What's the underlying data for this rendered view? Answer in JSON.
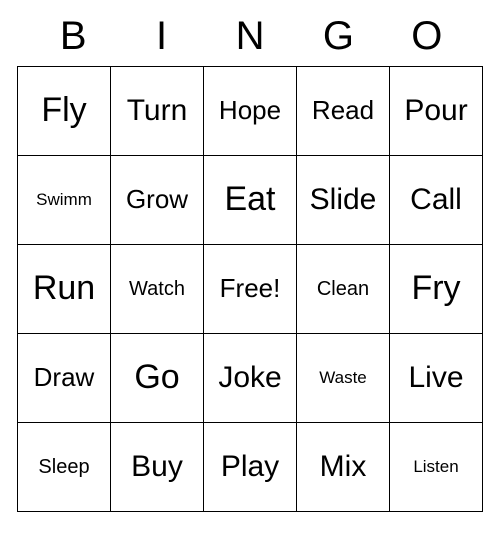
{
  "card": {
    "title_letters": [
      "B",
      "I",
      "N",
      "G",
      "O"
    ],
    "grid": [
      [
        {
          "text": "Fly",
          "size": "xl"
        },
        {
          "text": "Turn",
          "size": "lg"
        },
        {
          "text": "Hope",
          "size": "md"
        },
        {
          "text": "Read",
          "size": "md"
        },
        {
          "text": "Pour",
          "size": "lg"
        }
      ],
      [
        {
          "text": "Swimm",
          "size": "xs"
        },
        {
          "text": "Grow",
          "size": "md"
        },
        {
          "text": "Eat",
          "size": "xl"
        },
        {
          "text": "Slide",
          "size": "lg"
        },
        {
          "text": "Call",
          "size": "lg"
        }
      ],
      [
        {
          "text": "Run",
          "size": "xl"
        },
        {
          "text": "Watch",
          "size": "sm"
        },
        {
          "text": "Free!",
          "size": "md"
        },
        {
          "text": "Clean",
          "size": "sm"
        },
        {
          "text": "Fry",
          "size": "xl"
        }
      ],
      [
        {
          "text": "Draw",
          "size": "md"
        },
        {
          "text": "Go",
          "size": "xl"
        },
        {
          "text": "Joke",
          "size": "lg"
        },
        {
          "text": "Waste",
          "size": "xs"
        },
        {
          "text": "Live",
          "size": "lg"
        }
      ],
      [
        {
          "text": "Sleep",
          "size": "sm"
        },
        {
          "text": "Buy",
          "size": "lg"
        },
        {
          "text": "Play",
          "size": "lg"
        },
        {
          "text": "Mix",
          "size": "lg"
        },
        {
          "text": "Listen",
          "size": "xs"
        }
      ]
    ],
    "colors": {
      "background": "#ffffff",
      "text": "#000000",
      "border": "#000000"
    }
  }
}
